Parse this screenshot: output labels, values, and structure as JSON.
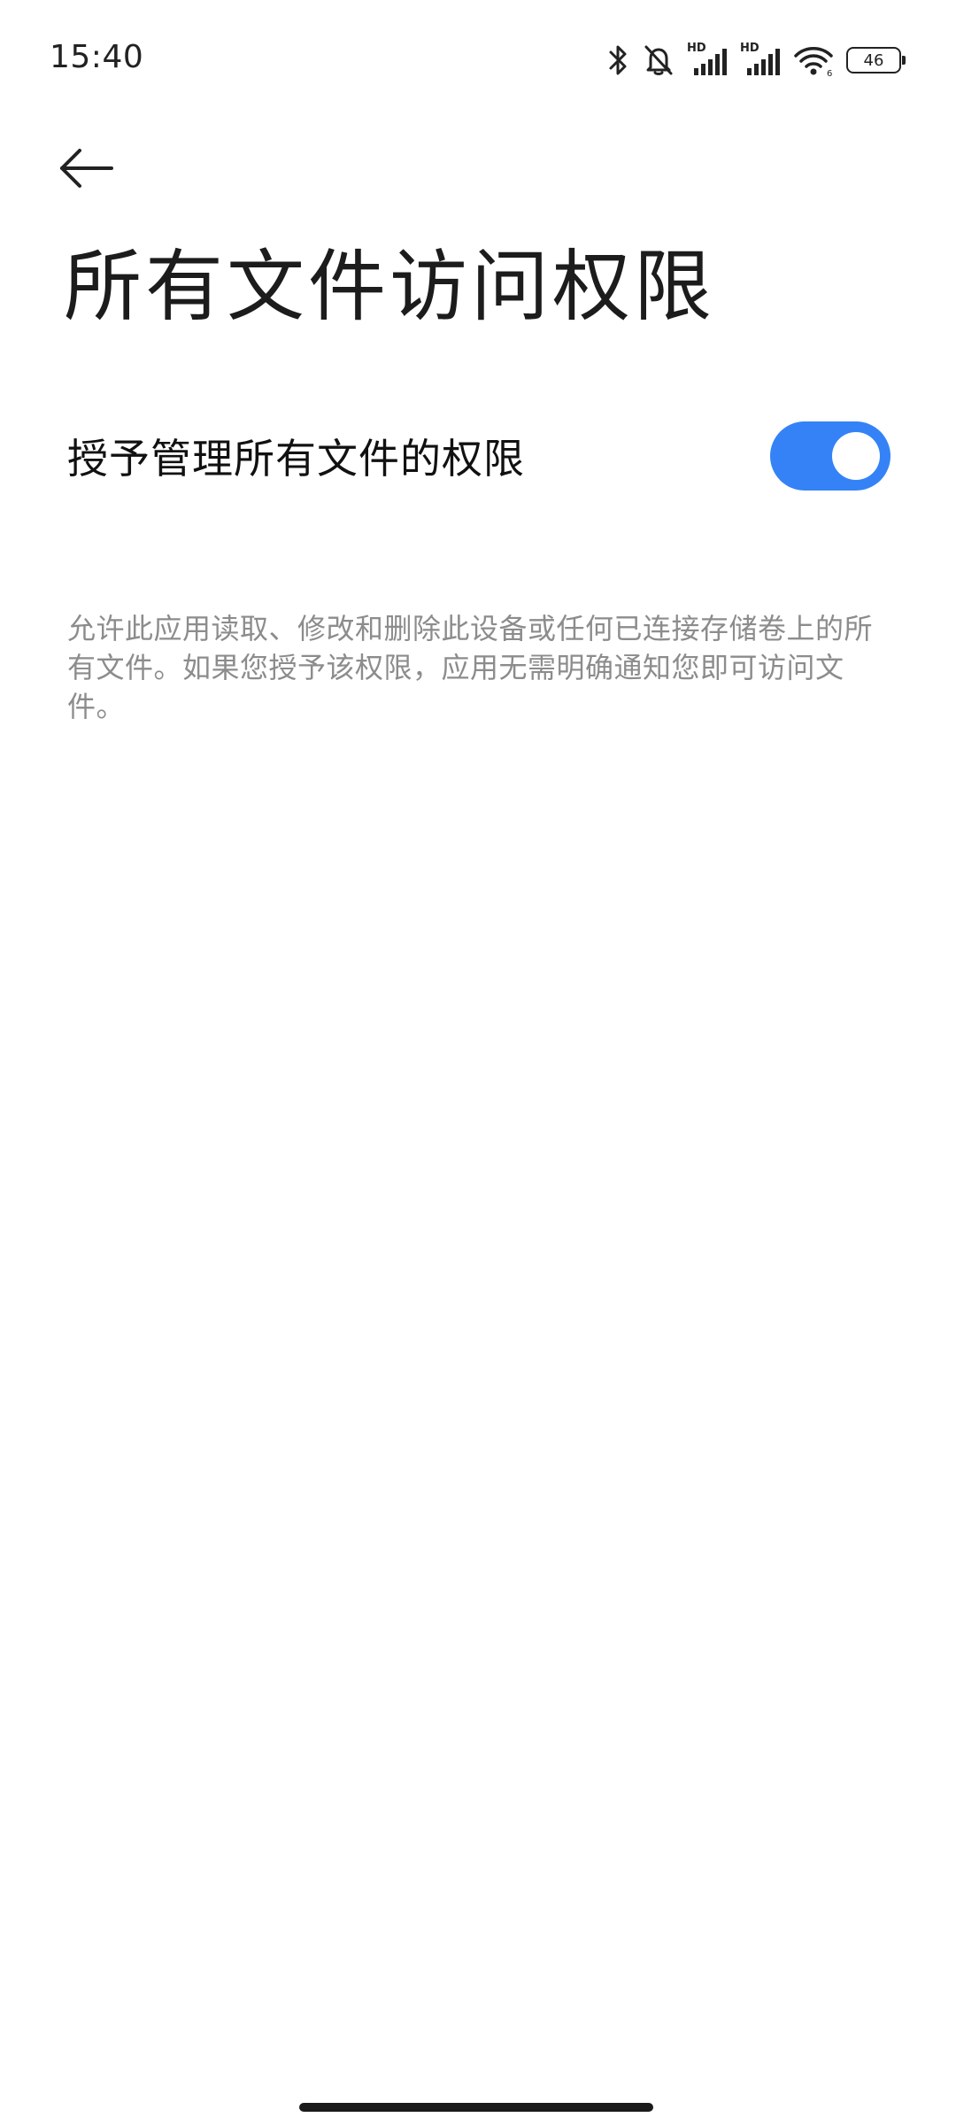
{
  "status_bar": {
    "time": "15:40",
    "battery_level": "46",
    "icons": [
      "bluetooth-icon",
      "mute-icon",
      "hd-signal-icon",
      "hd-signal-icon",
      "wifi-icon",
      "battery-icon"
    ],
    "hd_label": "HD"
  },
  "header": {
    "back_icon": "arrow-left-icon",
    "title": "所有文件访问权限"
  },
  "setting": {
    "label": "授予管理所有文件的权限",
    "enabled": true,
    "accent_color": "#3482f6"
  },
  "description": "允许此应用读取、修改和删除此设备或任何已连接存储卷上的所有文件。如果您授予该权限，应用无需明确通知您即可访问文件。"
}
